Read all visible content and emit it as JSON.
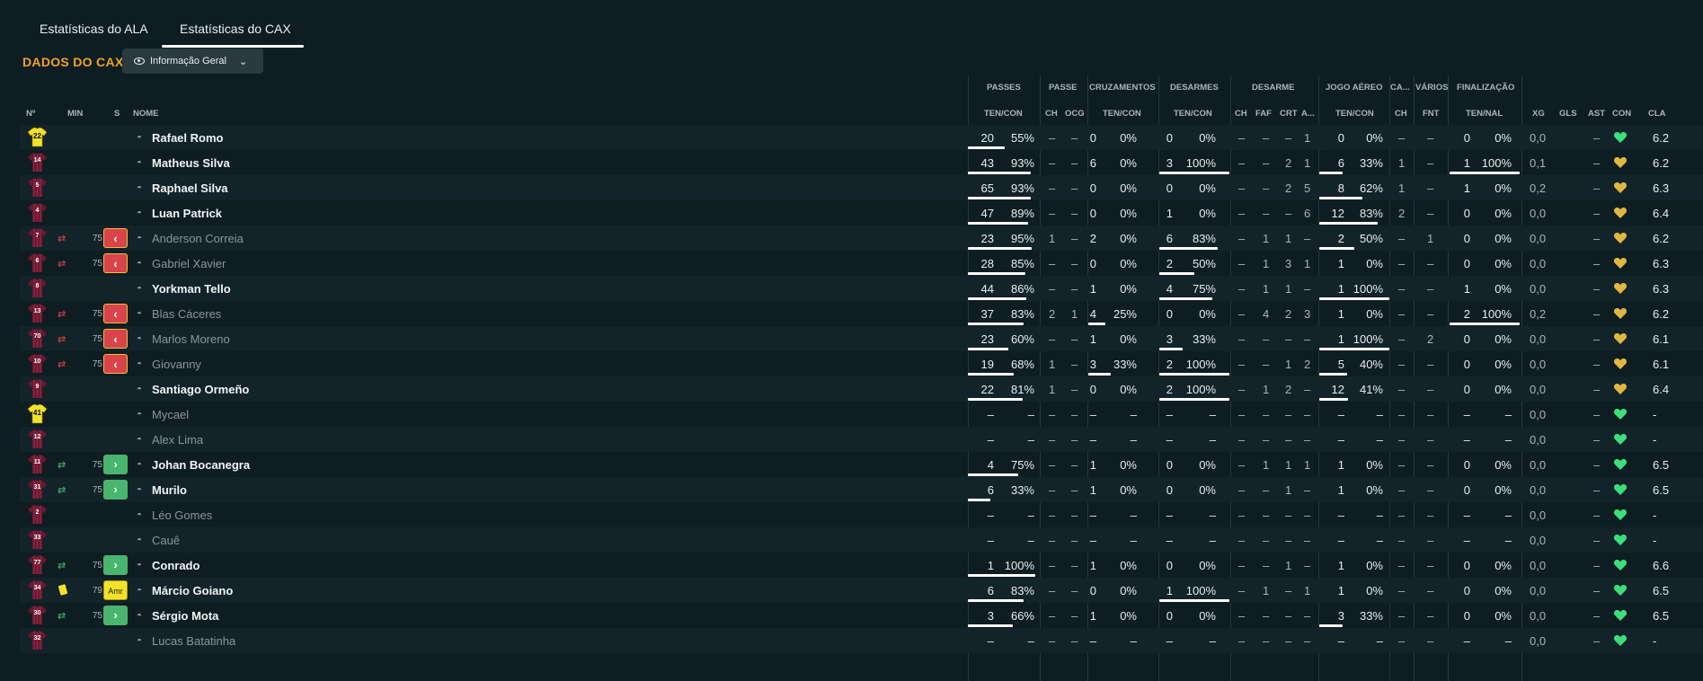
{
  "tabs": [
    {
      "label": "Estatísticas do ALA"
    },
    {
      "label": "Estatísticas do CAX"
    }
  ],
  "section_title": "DADOS DO CAX",
  "view_selector": "Informação Geral",
  "column_groups": [
    {
      "label": "PASSES"
    },
    {
      "label": "PASSE"
    },
    {
      "label": "CRUZAMENTOS"
    },
    {
      "label": "DESARMES"
    },
    {
      "label": "DESARME"
    },
    {
      "label": "JOGO AÉREO"
    },
    {
      "label": "CA..."
    },
    {
      "label": "VÁRIOS"
    },
    {
      "label": "FINALIZAÇÃO"
    }
  ],
  "columns": {
    "no": "Nº",
    "min": "MIN",
    "s": "S",
    "nome": "NOME",
    "passes": "TEN/CON",
    "ch": "CH",
    "ocg": "OCG",
    "cruz": "TEN/CON",
    "desarmes": "TEN/CON",
    "ch2": "CH",
    "faf": "FAF",
    "crt": "CRT",
    "a": "A...",
    "aereo": "TEN/CON",
    "ch3": "CH",
    "fnt": "FNT",
    "fin": "TEN/NAL",
    "xg": "XG",
    "gls": "GLS",
    "ast": "AST",
    "con": "CON",
    "cla": "CLA"
  },
  "colors": {
    "accent": "#f0a228",
    "out": "#d9434a",
    "in": "#49b56f",
    "heart_green": "#3be07a",
    "heart_yellow": "#e0b840"
  },
  "players": [
    {
      "no": "22",
      "gk": true,
      "sub": "",
      "min": "",
      "s": "",
      "name": "Rafael Romo",
      "dim": false,
      "p_t": "20",
      "p_p": "55%",
      "p_f": 0.55,
      "ch": "–",
      "ocg": "–",
      "cr_t": "0",
      "cr_p": "0%",
      "cr_f": 0,
      "d_t": "0",
      "d_p": "0%",
      "d_f": 0,
      "ch2": "–",
      "faf": "–",
      "crt": "–",
      "a": "1",
      "ae_t": "0",
      "ae_p": "0%",
      "ae_f": 0,
      "ch3": "–",
      "fnt": "–",
      "f_t": "0",
      "f_p": "0%",
      "f_f": 0,
      "xg": "0,0",
      "gls": "",
      "ast": "–",
      "con": "green",
      "cla": "6.2"
    },
    {
      "no": "14",
      "gk": false,
      "sub": "",
      "min": "",
      "s": "",
      "name": "Matheus Silva",
      "dim": false,
      "p_t": "43",
      "p_p": "93%",
      "p_f": 0.93,
      "ch": "–",
      "ocg": "–",
      "cr_t": "6",
      "cr_p": "0%",
      "cr_f": 0,
      "d_t": "3",
      "d_p": "100%",
      "d_f": 1,
      "ch2": "–",
      "faf": "–",
      "crt": "2",
      "a": "1",
      "ae_t": "6",
      "ae_p": "33%",
      "ae_f": 0.33,
      "ch3": "1",
      "fnt": "–",
      "f_t": "1",
      "f_p": "100%",
      "f_f": 1,
      "xg": "0,1",
      "gls": "",
      "ast": "–",
      "con": "yellow",
      "cla": "6.2"
    },
    {
      "no": "5",
      "gk": false,
      "sub": "",
      "min": "",
      "s": "",
      "name": "Raphael Silva",
      "dim": false,
      "p_t": "65",
      "p_p": "93%",
      "p_f": 0.93,
      "ch": "–",
      "ocg": "–",
      "cr_t": "0",
      "cr_p": "0%",
      "cr_f": 0,
      "d_t": "0",
      "d_p": "0%",
      "d_f": 0,
      "ch2": "–",
      "faf": "–",
      "crt": "2",
      "a": "5",
      "ae_t": "8",
      "ae_p": "62%",
      "ae_f": 0.62,
      "ch3": "1",
      "fnt": "–",
      "f_t": "1",
      "f_p": "0%",
      "f_f": 0,
      "xg": "0,2",
      "gls": "",
      "ast": "–",
      "con": "yellow",
      "cla": "6.3"
    },
    {
      "no": "4",
      "gk": false,
      "sub": "",
      "min": "",
      "s": "",
      "name": "Luan Patrick",
      "dim": false,
      "p_t": "47",
      "p_p": "89%",
      "p_f": 0.89,
      "ch": "–",
      "ocg": "–",
      "cr_t": "0",
      "cr_p": "0%",
      "cr_f": 0,
      "d_t": "1",
      "d_p": "0%",
      "d_f": 0,
      "ch2": "–",
      "faf": "–",
      "crt": "–",
      "a": "6",
      "ae_t": "12",
      "ae_p": "83%",
      "ae_f": 0.83,
      "ch3": "2",
      "fnt": "–",
      "f_t": "0",
      "f_p": "0%",
      "f_f": 0,
      "xg": "0,0",
      "gls": "",
      "ast": "–",
      "con": "yellow",
      "cla": "6.4"
    },
    {
      "no": "7",
      "gk": false,
      "sub": "out",
      "min": "75",
      "s": "out",
      "name": "Anderson Correia",
      "dim": true,
      "p_t": "23",
      "p_p": "95%",
      "p_f": 0.95,
      "ch": "1",
      "ocg": "–",
      "cr_t": "2",
      "cr_p": "0%",
      "cr_f": 0,
      "d_t": "6",
      "d_p": "83%",
      "d_f": 0.83,
      "ch2": "–",
      "faf": "1",
      "crt": "1",
      "a": "–",
      "ae_t": "2",
      "ae_p": "50%",
      "ae_f": 0.5,
      "ch3": "–",
      "fnt": "1",
      "f_t": "0",
      "f_p": "0%",
      "f_f": 0,
      "xg": "0,0",
      "gls": "",
      "ast": "–",
      "con": "yellow",
      "cla": "6.2"
    },
    {
      "no": "6",
      "gk": false,
      "sub": "out",
      "min": "75",
      "s": "out",
      "name": "Gabriel Xavier",
      "dim": true,
      "p_t": "28",
      "p_p": "85%",
      "p_f": 0.85,
      "ch": "–",
      "ocg": "–",
      "cr_t": "0",
      "cr_p": "0%",
      "cr_f": 0,
      "d_t": "2",
      "d_p": "50%",
      "d_f": 0.5,
      "ch2": "–",
      "faf": "1",
      "crt": "3",
      "a": "1",
      "ae_t": "1",
      "ae_p": "0%",
      "ae_f": 0,
      "ch3": "–",
      "fnt": "–",
      "f_t": "0",
      "f_p": "0%",
      "f_f": 0,
      "xg": "0,0",
      "gls": "",
      "ast": "–",
      "con": "yellow",
      "cla": "6.3"
    },
    {
      "no": "8",
      "gk": false,
      "sub": "",
      "min": "",
      "s": "",
      "name": "Yorkman Tello",
      "dim": false,
      "p_t": "44",
      "p_p": "86%",
      "p_f": 0.86,
      "ch": "–",
      "ocg": "–",
      "cr_t": "1",
      "cr_p": "0%",
      "cr_f": 0,
      "d_t": "4",
      "d_p": "75%",
      "d_f": 0.75,
      "ch2": "–",
      "faf": "1",
      "crt": "1",
      "a": "–",
      "ae_t": "1",
      "ae_p": "100%",
      "ae_f": 1,
      "ch3": "–",
      "fnt": "–",
      "f_t": "1",
      "f_p": "0%",
      "f_f": 0,
      "xg": "0,0",
      "gls": "",
      "ast": "–",
      "con": "yellow",
      "cla": "6.3"
    },
    {
      "no": "13",
      "gk": false,
      "sub": "out",
      "min": "75",
      "s": "out",
      "name": "Blas Cáceres",
      "dim": true,
      "p_t": "37",
      "p_p": "83%",
      "p_f": 0.83,
      "ch": "2",
      "ocg": "1",
      "cr_t": "4",
      "cr_p": "25%",
      "cr_f": 0.25,
      "d_t": "0",
      "d_p": "0%",
      "d_f": 0,
      "ch2": "–",
      "faf": "4",
      "crt": "2",
      "a": "3",
      "ae_t": "1",
      "ae_p": "0%",
      "ae_f": 0,
      "ch3": "–",
      "fnt": "–",
      "f_t": "2",
      "f_p": "100%",
      "f_f": 1,
      "xg": "0,2",
      "gls": "",
      "ast": "–",
      "con": "yellow",
      "cla": "6.2"
    },
    {
      "no": "70",
      "gk": false,
      "sub": "out",
      "min": "75",
      "s": "out",
      "name": "Marlos Moreno",
      "dim": true,
      "p_t": "23",
      "p_p": "60%",
      "p_f": 0.6,
      "ch": "–",
      "ocg": "–",
      "cr_t": "1",
      "cr_p": "0%",
      "cr_f": 0,
      "d_t": "3",
      "d_p": "33%",
      "d_f": 0.33,
      "ch2": "–",
      "faf": "–",
      "crt": "–",
      "a": "–",
      "ae_t": "1",
      "ae_p": "100%",
      "ae_f": 1,
      "ch3": "–",
      "fnt": "2",
      "f_t": "0",
      "f_p": "0%",
      "f_f": 0,
      "xg": "0,0",
      "gls": "",
      "ast": "–",
      "con": "yellow",
      "cla": "6.1"
    },
    {
      "no": "10",
      "gk": false,
      "sub": "out",
      "min": "75",
      "s": "out",
      "name": "Giovanny",
      "dim": true,
      "p_t": "19",
      "p_p": "68%",
      "p_f": 0.68,
      "ch": "1",
      "ocg": "–",
      "cr_t": "3",
      "cr_p": "33%",
      "cr_f": 0.33,
      "d_t": "2",
      "d_p": "100%",
      "d_f": 1,
      "ch2": "–",
      "faf": "–",
      "crt": "1",
      "a": "2",
      "ae_t": "5",
      "ae_p": "40%",
      "ae_f": 0.4,
      "ch3": "–",
      "fnt": "–",
      "f_t": "0",
      "f_p": "0%",
      "f_f": 0,
      "xg": "0,0",
      "gls": "",
      "ast": "–",
      "con": "yellow",
      "cla": "6.1"
    },
    {
      "no": "9",
      "gk": false,
      "sub": "",
      "min": "",
      "s": "",
      "name": "Santiago Ormeño",
      "dim": false,
      "p_t": "22",
      "p_p": "81%",
      "p_f": 0.81,
      "ch": "1",
      "ocg": "–",
      "cr_t": "0",
      "cr_p": "0%",
      "cr_f": 0,
      "d_t": "2",
      "d_p": "100%",
      "d_f": 1,
      "ch2": "–",
      "faf": "1",
      "crt": "2",
      "a": "–",
      "ae_t": "12",
      "ae_p": "41%",
      "ae_f": 0.41,
      "ch3": "–",
      "fnt": "–",
      "f_t": "0",
      "f_p": "0%",
      "f_f": 0,
      "xg": "0,0",
      "gls": "",
      "ast": "–",
      "con": "yellow",
      "cla": "6.4"
    },
    {
      "no": "41",
      "gk": true,
      "sub": "",
      "min": "",
      "s": "",
      "name": "Mycael",
      "dim": true,
      "p_t": "–",
      "p_p": "–",
      "p_f": 0,
      "ch": "–",
      "ocg": "–",
      "cr_t": "–",
      "cr_p": "–",
      "cr_f": 0,
      "d_t": "–",
      "d_p": "–",
      "d_f": 0,
      "ch2": "–",
      "faf": "–",
      "crt": "–",
      "a": "–",
      "ae_t": "–",
      "ae_p": "–",
      "ae_f": 0,
      "ch3": "–",
      "fnt": "–",
      "f_t": "–",
      "f_p": "–",
      "f_f": 0,
      "xg": "0,0",
      "gls": "",
      "ast": "–",
      "con": "green",
      "cla": "-"
    },
    {
      "no": "12",
      "gk": false,
      "sub": "",
      "min": "",
      "s": "",
      "name": "Alex Lima",
      "dim": true,
      "p_t": "–",
      "p_p": "–",
      "p_f": 0,
      "ch": "–",
      "ocg": "–",
      "cr_t": "–",
      "cr_p": "–",
      "cr_f": 0,
      "d_t": "–",
      "d_p": "–",
      "d_f": 0,
      "ch2": "–",
      "faf": "–",
      "crt": "–",
      "a": "–",
      "ae_t": "–",
      "ae_p": "–",
      "ae_f": 0,
      "ch3": "–",
      "fnt": "–",
      "f_t": "–",
      "f_p": "–",
      "f_f": 0,
      "xg": "0,0",
      "gls": "",
      "ast": "–",
      "con": "green",
      "cla": "-"
    },
    {
      "no": "11",
      "gk": false,
      "sub": "in",
      "min": "75",
      "s": "in",
      "name": "Johan Bocanegra",
      "dim": false,
      "p_t": "4",
      "p_p": "75%",
      "p_f": 0.75,
      "ch": "–",
      "ocg": "–",
      "cr_t": "1",
      "cr_p": "0%",
      "cr_f": 0,
      "d_t": "0",
      "d_p": "0%",
      "d_f": 0,
      "ch2": "–",
      "faf": "1",
      "crt": "1",
      "a": "1",
      "ae_t": "1",
      "ae_p": "0%",
      "ae_f": 0,
      "ch3": "–",
      "fnt": "–",
      "f_t": "0",
      "f_p": "0%",
      "f_f": 0,
      "xg": "0,0",
      "gls": "",
      "ast": "–",
      "con": "green",
      "cla": "6.5"
    },
    {
      "no": "31",
      "gk": false,
      "sub": "in",
      "min": "75",
      "s": "in",
      "name": "Murilo",
      "dim": false,
      "p_t": "6",
      "p_p": "33%",
      "p_f": 0.33,
      "ch": "–",
      "ocg": "–",
      "cr_t": "1",
      "cr_p": "0%",
      "cr_f": 0,
      "d_t": "0",
      "d_p": "0%",
      "d_f": 0,
      "ch2": "–",
      "faf": "–",
      "crt": "1",
      "a": "–",
      "ae_t": "1",
      "ae_p": "0%",
      "ae_f": 0,
      "ch3": "–",
      "fnt": "–",
      "f_t": "0",
      "f_p": "0%",
      "f_f": 0,
      "xg": "0,0",
      "gls": "",
      "ast": "–",
      "con": "green",
      "cla": "6.5"
    },
    {
      "no": "2",
      "gk": false,
      "sub": "",
      "min": "",
      "s": "",
      "name": "Léo Gomes",
      "dim": true,
      "p_t": "–",
      "p_p": "–",
      "p_f": 0,
      "ch": "–",
      "ocg": "–",
      "cr_t": "–",
      "cr_p": "–",
      "cr_f": 0,
      "d_t": "–",
      "d_p": "–",
      "d_f": 0,
      "ch2": "–",
      "faf": "–",
      "crt": "–",
      "a": "–",
      "ae_t": "–",
      "ae_p": "–",
      "ae_f": 0,
      "ch3": "–",
      "fnt": "–",
      "f_t": "–",
      "f_p": "–",
      "f_f": 0,
      "xg": "0,0",
      "gls": "",
      "ast": "–",
      "con": "green",
      "cla": "-"
    },
    {
      "no": "33",
      "gk": false,
      "sub": "",
      "min": "",
      "s": "",
      "name": "Cauê",
      "dim": true,
      "p_t": "–",
      "p_p": "–",
      "p_f": 0,
      "ch": "–",
      "ocg": "–",
      "cr_t": "–",
      "cr_p": "–",
      "cr_f": 0,
      "d_t": "–",
      "d_p": "–",
      "d_f": 0,
      "ch2": "–",
      "faf": "–",
      "crt": "–",
      "a": "–",
      "ae_t": "–",
      "ae_p": "–",
      "ae_f": 0,
      "ch3": "–",
      "fnt": "–",
      "f_t": "–",
      "f_p": "–",
      "f_f": 0,
      "xg": "0,0",
      "gls": "",
      "ast": "–",
      "con": "green",
      "cla": "-"
    },
    {
      "no": "77",
      "gk": false,
      "sub": "in",
      "min": "75",
      "s": "in",
      "name": "Conrado",
      "dim": false,
      "p_t": "1",
      "p_p": "100%",
      "p_f": 1,
      "ch": "–",
      "ocg": "–",
      "cr_t": "1",
      "cr_p": "0%",
      "cr_f": 0,
      "d_t": "0",
      "d_p": "0%",
      "d_f": 0,
      "ch2": "–",
      "faf": "–",
      "crt": "1",
      "a": "–",
      "ae_t": "1",
      "ae_p": "0%",
      "ae_f": 0,
      "ch3": "–",
      "fnt": "–",
      "f_t": "0",
      "f_p": "0%",
      "f_f": 0,
      "xg": "0,0",
      "gls": "",
      "ast": "–",
      "con": "green",
      "cla": "6.6"
    },
    {
      "no": "34",
      "gk": false,
      "sub": "card",
      "min": "79",
      "s": "card",
      "s_label": "Amr",
      "name": "Márcio Goiano",
      "dim": false,
      "p_t": "6",
      "p_p": "83%",
      "p_f": 0.83,
      "ch": "–",
      "ocg": "–",
      "cr_t": "0",
      "cr_p": "0%",
      "cr_f": 0,
      "d_t": "1",
      "d_p": "100%",
      "d_f": 1,
      "ch2": "–",
      "faf": "1",
      "crt": "–",
      "a": "1",
      "ae_t": "1",
      "ae_p": "0%",
      "ae_f": 0,
      "ch3": "–",
      "fnt": "–",
      "f_t": "0",
      "f_p": "0%",
      "f_f": 0,
      "xg": "0,0",
      "gls": "",
      "ast": "–",
      "con": "green",
      "cla": "6.5"
    },
    {
      "no": "30",
      "gk": false,
      "sub": "in",
      "min": "75",
      "s": "in",
      "name": "Sérgio Mota",
      "dim": false,
      "p_t": "3",
      "p_p": "66%",
      "p_f": 0.66,
      "ch": "–",
      "ocg": "–",
      "cr_t": "1",
      "cr_p": "0%",
      "cr_f": 0,
      "d_t": "0",
      "d_p": "0%",
      "d_f": 0,
      "ch2": "–",
      "faf": "–",
      "crt": "–",
      "a": "–",
      "ae_t": "3",
      "ae_p": "33%",
      "ae_f": 0.33,
      "ch3": "–",
      "fnt": "–",
      "f_t": "0",
      "f_p": "0%",
      "f_f": 0,
      "xg": "0,0",
      "gls": "",
      "ast": "–",
      "con": "green",
      "cla": "6.5"
    },
    {
      "no": "32",
      "gk": false,
      "sub": "",
      "min": "",
      "s": "",
      "name": "Lucas Batatinha",
      "dim": true,
      "p_t": "–",
      "p_p": "–",
      "p_f": 0,
      "ch": "–",
      "ocg": "–",
      "cr_t": "–",
      "cr_p": "–",
      "cr_f": 0,
      "d_t": "–",
      "d_p": "–",
      "d_f": 0,
      "ch2": "–",
      "faf": "–",
      "crt": "–",
      "a": "–",
      "ae_t": "–",
      "ae_p": "–",
      "ae_f": 0,
      "ch3": "–",
      "fnt": "–",
      "f_t": "–",
      "f_p": "–",
      "f_f": 0,
      "xg": "0,0",
      "gls": "",
      "ast": "–",
      "con": "green",
      "cla": "-"
    }
  ]
}
